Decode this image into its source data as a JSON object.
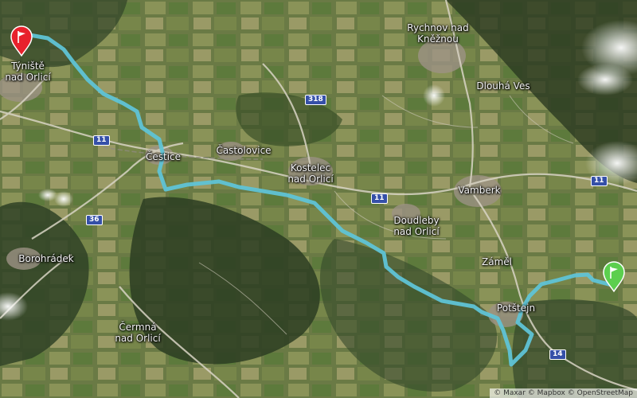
{
  "map": {
    "type": "satellite",
    "colors": {
      "route": "#5fc3d6",
      "start_flag": "#e8212c",
      "end_flag": "#5ccf4e",
      "road": "#d8d4c4",
      "road_shield": "#3550a8"
    },
    "places": [
      {
        "name": "Týniště\nnad Orlicí"
      },
      {
        "name": "Rychnov nad\nKněžnou"
      },
      {
        "name": "Dlouhá Ves"
      },
      {
        "name": "Častolovice"
      },
      {
        "name": "Čestice"
      },
      {
        "name": "Kostelec\nnad Orlicí"
      },
      {
        "name": "Vamberk"
      },
      {
        "name": "Doudleby\nnad Orlicí"
      },
      {
        "name": "Borohrádek"
      },
      {
        "name": "Záměl"
      },
      {
        "name": "Potštejn"
      },
      {
        "name": "Čermná\nnad Orlicí"
      }
    ],
    "road_shields": [
      "318",
      "11",
      "11",
      "36",
      "11",
      "14"
    ],
    "markers": {
      "start": "start-flag-icon",
      "end": "finish-flag-icon"
    },
    "attribution": "© Maxar © Mapbox © OpenStreetMap"
  }
}
